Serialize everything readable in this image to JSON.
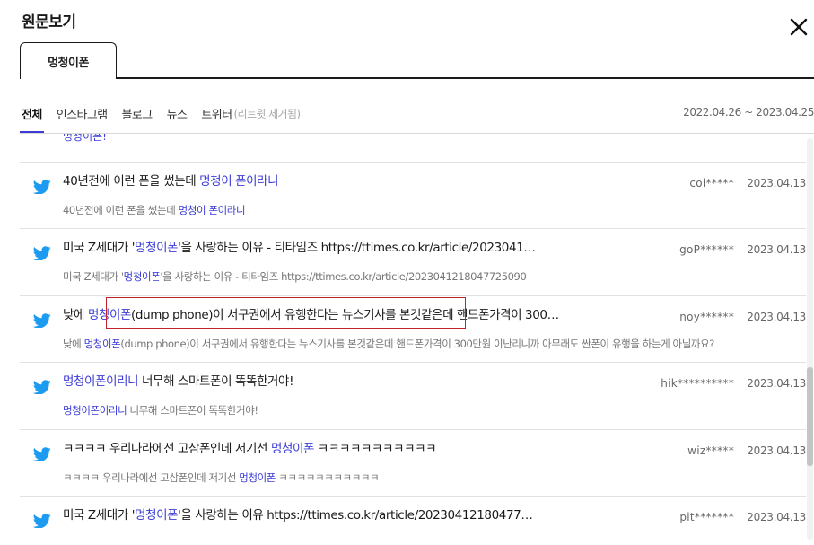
{
  "header": {
    "title": "원문보기"
  },
  "tabs": [
    {
      "label": "멍청이폰"
    }
  ],
  "filters": {
    "items": [
      "전체",
      "인스타그램",
      "블로그",
      "뉴스",
      "트위터"
    ],
    "twitter_note": "(리트윗 제거됨)",
    "date_range": "2022.04.26 ~ 2023.04.25"
  },
  "partial_top_text": "멍청이폰!",
  "posts": [
    {
      "headline_parts": [
        [
          "40년전에 이런 폰을 썼는데 ",
          false
        ],
        [
          "멍청이 폰이라니",
          true
        ]
      ],
      "snippet_parts": [
        [
          "40년전에 이런 폰을 썼는데 ",
          false
        ],
        [
          "멍청이 폰이라니",
          true
        ]
      ],
      "user": "coi*****",
      "date": "2023.04.13"
    },
    {
      "headline_parts": [
        [
          "미국 Z세대가 '",
          false
        ],
        [
          "멍청이폰",
          true
        ],
        [
          "'을 사랑하는 이유 - 티타임즈 https://ttimes.co.kr/article/2023041…",
          false
        ]
      ],
      "snippet_parts": [
        [
          "미국 Z세대가 '",
          false
        ],
        [
          "멍청이폰",
          true
        ],
        [
          "'을 사랑하는 이유 - 티타임즈 https://ttimes.co.kr/article/2023041218047725090",
          false
        ]
      ],
      "user": "goP******",
      "date": "2023.04.13"
    },
    {
      "headline_parts": [
        [
          "낮에 ",
          false
        ],
        [
          "멍청이폰",
          true
        ],
        [
          "(dump phone)이 서구권에서 유행한다는 뉴스기사를 본것같은데 핸드폰가격이 300…",
          false
        ]
      ],
      "snippet_parts": [
        [
          "낮에 ",
          false
        ],
        [
          "멍청이폰",
          true
        ],
        [
          "(dump phone)이 서구권에서 유행한다는 뉴스기사를 본것같은데 핸드폰가격이 300만원 이난리니까 아무래도 싼폰이 유행을 하는게 아닐까요?",
          false
        ]
      ],
      "user": "noy******",
      "date": "2023.04.13"
    },
    {
      "headline_parts": [
        [
          "멍청이폰이리니",
          true
        ],
        [
          " 너무해 스마트폰이 똑똑한거야!",
          false
        ]
      ],
      "snippet_parts": [
        [
          "멍청이폰이리니",
          true
        ],
        [
          " 너무해 스마트폰이 똑똑한거야!",
          false
        ]
      ],
      "user": "hik**********",
      "date": "2023.04.13"
    },
    {
      "headline_parts": [
        [
          "ㅋㅋㅋㅋ 우리나라에선 고삼폰인데 저기선 ",
          false
        ],
        [
          "멍청이폰",
          true
        ],
        [
          " ㅋㅋㅋㅋㅋㅋㅋㅋㅋㅋㅋ",
          false
        ]
      ],
      "snippet_parts": [
        [
          "ㅋㅋㅋㅋ 우리나라에선 고삼폰인데 저기선 ",
          false
        ],
        [
          "멍청이폰",
          true
        ],
        [
          " ㅋㅋㅋㅋㅋㅋㅋㅋㅋㅋㅋ",
          false
        ]
      ],
      "user": "wiz*****",
      "date": "2023.04.13"
    },
    {
      "headline_parts": [
        [
          "미국 Z세대가 '",
          false
        ],
        [
          "멍청이폰",
          true
        ],
        [
          "'을 사랑하는 이유 https://ttimes.co.kr/article/20230412180477…",
          false
        ]
      ],
      "snippet_parts": [],
      "user": "pit*******",
      "date": "2023.04.13"
    }
  ],
  "colors": {
    "keyword": "#3b3bd6",
    "twitter": "#1d9bf0",
    "highlight_box": "#c0242a"
  }
}
